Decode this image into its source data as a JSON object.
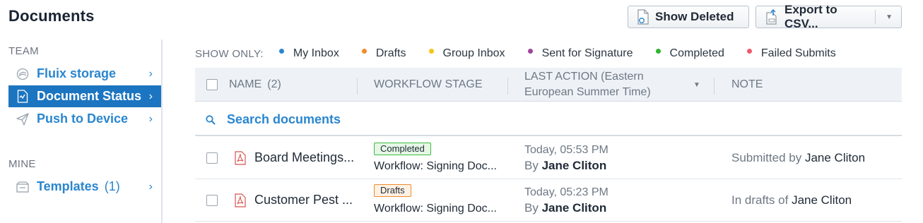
{
  "page": {
    "title": "Documents"
  },
  "toolbar": {
    "show_deleted_label": "Show Deleted",
    "export_label": "Export to CSV..."
  },
  "sidebar": {
    "team_title": "TEAM",
    "mine_title": "MINE",
    "items": [
      {
        "label": "Fluix storage",
        "icon": "storage-icon",
        "active": false
      },
      {
        "label": "Document Status",
        "icon": "document-status-icon",
        "active": true
      },
      {
        "label": "Push to Device",
        "icon": "send-icon",
        "active": false
      },
      {
        "label": "Templates",
        "count": "(1)",
        "icon": "templates-icon",
        "active": false
      }
    ]
  },
  "filters": {
    "label": "SHOW ONLY:",
    "items": [
      {
        "label": "My Inbox",
        "color": "#2a86cf"
      },
      {
        "label": "Drafts",
        "color": "#f08b2e"
      },
      {
        "label": "Group Inbox",
        "color": "#f5c51b"
      },
      {
        "label": "Sent for Signature",
        "color": "#a0449a"
      },
      {
        "label": "Completed",
        "color": "#2bb52b"
      },
      {
        "label": "Failed Submits",
        "color": "#ef5a6a"
      }
    ]
  },
  "table": {
    "headers": {
      "name": "NAME",
      "name_count": "(2)",
      "workflow_stage": "WORKFLOW STAGE",
      "last_action_line1": "LAST ACTION (Eastern",
      "last_action_line2": "European Summer Time)",
      "note": "NOTE"
    },
    "search_placeholder": "Search documents",
    "rows": [
      {
        "name": "Board Meetings...",
        "badge": "Completed",
        "workflow": "Workflow: Signing Doc...",
        "time": "Today, 05:53 PM",
        "by_prefix": "By",
        "by_name": "Jane Cliton",
        "note_prefix": "Submitted by",
        "note_name": "Jane Cliton"
      },
      {
        "name": "Customer Pest ...",
        "badge": "Drafts",
        "workflow": "Workflow: Signing Doc...",
        "time": "Today, 05:23 PM",
        "by_prefix": "By",
        "by_name": "Jane Cliton",
        "note_prefix": "In drafts of",
        "note_name": "Jane Cliton"
      }
    ]
  }
}
